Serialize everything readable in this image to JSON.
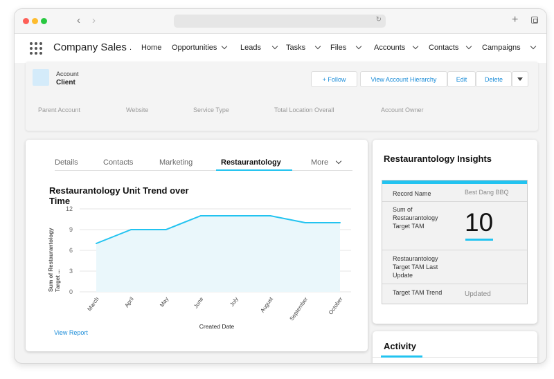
{
  "nav": {
    "app_name": "Company Sales",
    "items": [
      {
        "label": "Home"
      },
      {
        "label": "Opportunities"
      },
      {
        "label": "Leads"
      },
      {
        "label": "Tasks"
      },
      {
        "label": "Files"
      },
      {
        "label": "Accounts"
      },
      {
        "label": "Contacts"
      },
      {
        "label": "Campaigns"
      }
    ]
  },
  "account": {
    "object_label": "Account",
    "name": "Client",
    "buttons": {
      "follow": "+ Follow",
      "hierarchy": "View Account Hierarchy",
      "edit": "Edit",
      "delete": "Delete"
    },
    "fields": [
      "Parent Account",
      "Website",
      "Service Type",
      "Total Location Overall",
      "Account Owner"
    ]
  },
  "tabs": {
    "details": "Details",
    "contacts": "Contacts",
    "marketing": "Marketing",
    "restaurantology": "Restaurantology",
    "more": "More"
  },
  "chart": {
    "title": "Restaurantology Unit Trend over Time",
    "view_report": "View Report"
  },
  "chart_data": {
    "type": "area",
    "title": "Restaurantology Unit Trend over Time",
    "xlabel": "Created Date",
    "ylabel": "Sum of Restaurantology Target ...",
    "categories": [
      "March",
      "April",
      "May",
      "June",
      "July",
      "August",
      "September",
      "October"
    ],
    "values": [
      7,
      9,
      9,
      11,
      11,
      11,
      10,
      10
    ],
    "yticks": [
      0,
      3,
      6,
      9,
      12
    ],
    "ylim": [
      0,
      12
    ],
    "grid": true,
    "fill_color": "#eaf7fb",
    "line_color": "#22c3f0"
  },
  "insights": {
    "title": "Restaurantology Insights",
    "record_name_label": "Record Name",
    "record_name_value": "Best Dang BBQ",
    "sum_label": "Sum of Restaurantology Target TAM",
    "sum_value": "10",
    "last_update_label": "Restaurantology Target TAM Last Update",
    "trend_label": "Target TAM Trend",
    "trend_value": "Updated"
  },
  "activity": {
    "title": "Activity"
  },
  "colors": {
    "accent": "#22c3f0",
    "link": "#1a8cd8"
  }
}
